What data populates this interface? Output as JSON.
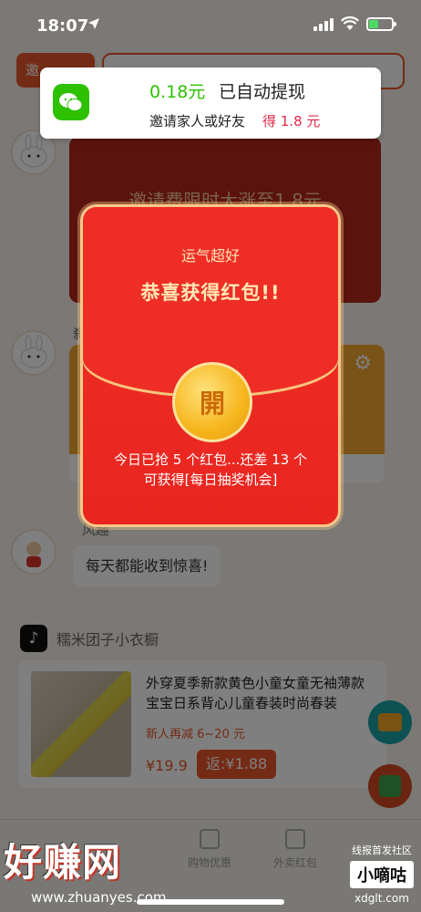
{
  "status_bar": {
    "time": "18:07"
  },
  "notification": {
    "amount": "0.18元",
    "status": "已自动提现",
    "subtitle": "邀请家人或好友",
    "reward": "得 1.8 元"
  },
  "background": {
    "invite_label": "邀",
    "card1_text": "邀请费限时大涨至1.8元",
    "sender2": "刹",
    "sender3": "风趣",
    "bubble3": "每天都能收到惊喜!",
    "shop_name": "糯米团子小衣橱",
    "product": {
      "title": "外穿夏季新款黄色小童女童无袖薄款宝宝日系背心儿童春装时尚春装",
      "tag": "新人再减 6~20 元",
      "price": "¥19.9",
      "rebate": "返:¥1.88"
    },
    "nav": [
      "购物优惠",
      "外卖红包"
    ]
  },
  "envelope": {
    "luck": "运气超好",
    "title": "恭喜获得红包!!",
    "open": "開",
    "desc_line1": "今日已抢 5 个红包...还差 13 个",
    "desc_line2": "可获得[每日抽奖机会]"
  },
  "watermark": {
    "logo": "好赚网",
    "url": "www.zhuanyes.com",
    "right_top": "线报首发社区",
    "right_mid": "小嘀咕",
    "right_bottom": "xdglt.com"
  },
  "colors": {
    "accent": "#e8562a",
    "wechat_green": "#2dc100",
    "envelope_red": "#ee2e26",
    "gold": "#f6b51c"
  }
}
